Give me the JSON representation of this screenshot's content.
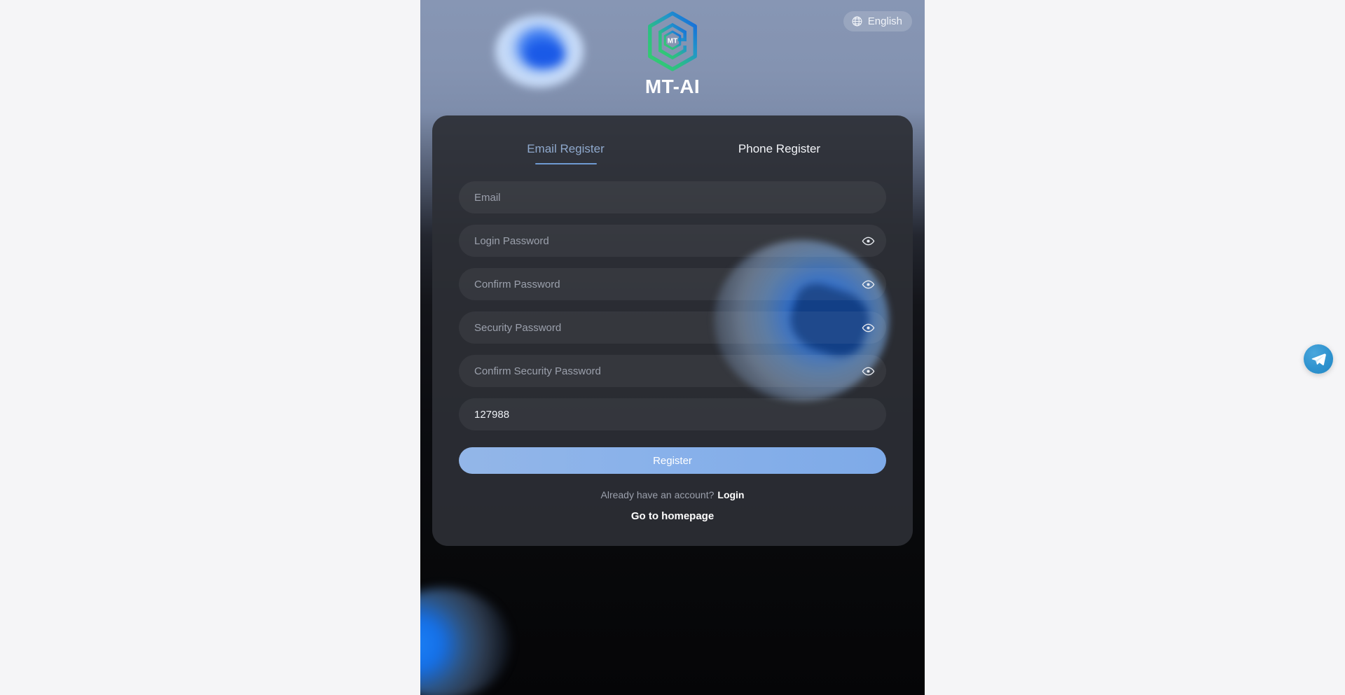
{
  "brand": {
    "name": "MT-AI",
    "logo_icon": "mt-hexagon-logo",
    "logo_text": "MT"
  },
  "language": {
    "label": "English",
    "icon": "globe-icon"
  },
  "card": {
    "tabs": [
      {
        "label": "Email Register",
        "active": true
      },
      {
        "label": "Phone Register",
        "active": false
      }
    ],
    "fields": [
      {
        "name": "email",
        "placeholder": "Email",
        "value": "",
        "has_eye": false
      },
      {
        "name": "login-password",
        "placeholder": "Login Password",
        "value": "",
        "has_eye": true
      },
      {
        "name": "confirm-password",
        "placeholder": "Confirm Password",
        "value": "",
        "has_eye": true
      },
      {
        "name": "security-password",
        "placeholder": "Security Password",
        "value": "",
        "has_eye": true
      },
      {
        "name": "confirm-security-password",
        "placeholder": "Confirm Security Password",
        "value": "",
        "has_eye": true
      },
      {
        "name": "invitation-code",
        "placeholder": "",
        "value": "127988",
        "has_eye": false
      }
    ],
    "submit_label": "Register",
    "already_have_account": "Already have an account?",
    "login_link": "Login",
    "homepage_link": "Go to homepage"
  },
  "fab": {
    "icon": "telegram-icon"
  },
  "colors": {
    "accent_blue": "#8ab2ea",
    "tab_active": "#8fa9cd",
    "card_bg": "#2d2f35",
    "header_blue": "#8796b4",
    "telegram_blue": "#2f93cf",
    "logo_green": "#2fc36a",
    "logo_blue": "#1a6ee0"
  }
}
